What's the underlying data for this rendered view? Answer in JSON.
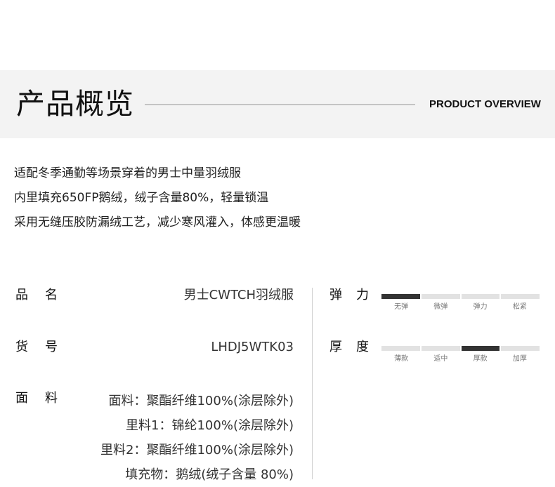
{
  "header": {
    "title_cn": "产品概览",
    "title_en": "PRODUCT OVERVIEW"
  },
  "intro": {
    "lines": [
      "适配冬季通勤等场景穿着的男士中量羽绒服",
      "内里填充650FP鹅绒，绒子含量80%，轻量锁温",
      "采用无缝压胶防漏绒工艺，减少寒风灌入，体感更温暖"
    ]
  },
  "specs": {
    "name": {
      "label": "品名",
      "value": "男士CWTCH羽绒服"
    },
    "sku": {
      "label": "货号",
      "value": "LHDJ5WTK03"
    },
    "material": {
      "label": "面料",
      "lines": [
        "面料：聚酯纤维100%(涂层除外)",
        "里料1：锦纶100%(涂层除外)",
        "里料2：聚酯纤维100%(涂层除外)",
        "填充物：鹅绒(绒子含量 80%)"
      ]
    }
  },
  "scales": {
    "elasticity": {
      "label": "弹力",
      "ticks": [
        "无弹",
        "微弹",
        "弹力",
        "松紧"
      ],
      "active_index": 0
    },
    "thickness": {
      "label": "厚度",
      "ticks": [
        "薄款",
        "适中",
        "厚款",
        "加厚"
      ],
      "active_index": 2
    },
    "active_color": "#333333",
    "inactive_color": "#e2e2e2"
  }
}
